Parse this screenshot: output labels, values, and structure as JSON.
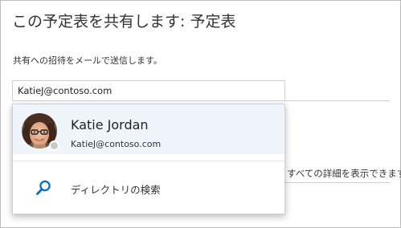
{
  "dialog": {
    "title": "この予定表を共有します: 予定表",
    "subtitle": "共有への招待をメールで送信します。"
  },
  "email_input": {
    "value": "KatieJ@contoso.com"
  },
  "background": {
    "details_text": "すべての詳細を表示できます"
  },
  "dropdown": {
    "suggestion": {
      "name": "Katie Jordan",
      "email": "KatieJ@contoso.com",
      "presence_color": "#c9c9c9"
    },
    "directory_search": {
      "label": "ディレクトリの検索",
      "icon": "search-icon"
    }
  },
  "colors": {
    "accent": "#0a6dc2",
    "highlight_bg": "#eef6fc"
  }
}
